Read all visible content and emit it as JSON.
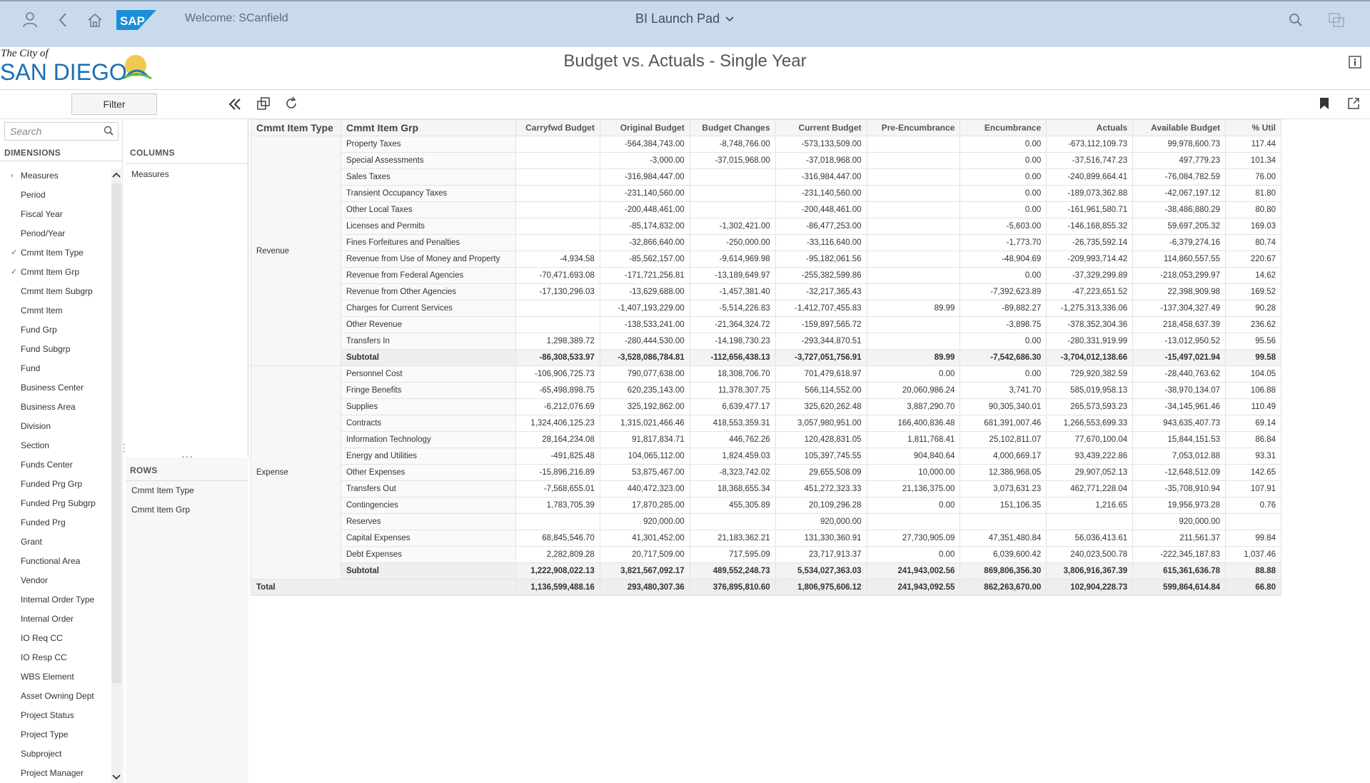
{
  "shell": {
    "welcome": "Welcome: SCanfield",
    "launchpad": "BI Launch Pad",
    "brand": "SAP"
  },
  "report": {
    "logo_top": "The City of",
    "logo_main": "SAN DIEGO",
    "title": "Budget vs. Actuals - Single Year"
  },
  "toolbar": {
    "filter_label": "Filter"
  },
  "dims": {
    "search_placeholder": "Search",
    "header": "DIMENSIONS",
    "items": [
      {
        "label": "Measures",
        "mark": "›"
      },
      {
        "label": "Period",
        "mark": ""
      },
      {
        "label": "Fiscal Year",
        "mark": ""
      },
      {
        "label": "Period/Year",
        "mark": ""
      },
      {
        "label": "Cmmt Item Type",
        "mark": "✓"
      },
      {
        "label": "Cmmt Item Grp",
        "mark": "✓"
      },
      {
        "label": "Cmmt Item Subgrp",
        "mark": ""
      },
      {
        "label": "Cmmt Item",
        "mark": ""
      },
      {
        "label": "Fund Grp",
        "mark": ""
      },
      {
        "label": "Fund Subgrp",
        "mark": ""
      },
      {
        "label": "Fund",
        "mark": ""
      },
      {
        "label": "Business Center",
        "mark": ""
      },
      {
        "label": "Business Area",
        "mark": ""
      },
      {
        "label": "Division",
        "mark": ""
      },
      {
        "label": "Section",
        "mark": ""
      },
      {
        "label": "Funds Center",
        "mark": ""
      },
      {
        "label": "Funded Prg Grp",
        "mark": ""
      },
      {
        "label": "Funded Prg Subgrp",
        "mark": ""
      },
      {
        "label": "Funded Prg",
        "mark": ""
      },
      {
        "label": "Grant",
        "mark": ""
      },
      {
        "label": "Functional Area",
        "mark": ""
      },
      {
        "label": "Vendor",
        "mark": ""
      },
      {
        "label": "Internal Order Type",
        "mark": ""
      },
      {
        "label": "Internal Order",
        "mark": ""
      },
      {
        "label": "IO Req CC",
        "mark": ""
      },
      {
        "label": "IO Resp CC",
        "mark": ""
      },
      {
        "label": "WBS Element",
        "mark": ""
      },
      {
        "label": "Asset Owning Dept",
        "mark": ""
      },
      {
        "label": "Project Status",
        "mark": ""
      },
      {
        "label": "Project Type",
        "mark": ""
      },
      {
        "label": "Subproject",
        "mark": ""
      },
      {
        "label": "Project Manager",
        "mark": ""
      }
    ]
  },
  "panels": {
    "columns_header": "COLUMNS",
    "columns": [
      "Measures"
    ],
    "rows_header": "ROWS",
    "rows": [
      "Cmmt Item Type",
      "Cmmt Item Grp"
    ]
  },
  "table": {
    "headers": [
      "Cmmt Item Type",
      "Cmmt Item Grp",
      "Carryfwd  Budget",
      "Original Budget",
      "Budget Changes",
      "Current Budget",
      "Pre-Encumbrance",
      "Encumbrance",
      "Actuals",
      "Available Budget",
      "% Util"
    ],
    "revenue_label": "Revenue",
    "revenue": [
      [
        "Property Taxes",
        "",
        "-564,384,743.00",
        "-8,748,766.00",
        "-573,133,509.00",
        "",
        "0.00",
        "-673,112,109.73",
        "99,978,600.73",
        "117.44"
      ],
      [
        "Special Assessments",
        "",
        "-3,000.00",
        "-37,015,968.00",
        "-37,018,968.00",
        "",
        "0.00",
        "-37,516,747.23",
        "497,779.23",
        "101.34"
      ],
      [
        "Sales Taxes",
        "",
        "-316,984,447.00",
        "",
        "-316,984,447.00",
        "",
        "0.00",
        "-240,899,664.41",
        "-76,084,782.59",
        "76.00"
      ],
      [
        "Transient Occupancy Taxes",
        "",
        "-231,140,560.00",
        "",
        "-231,140,560.00",
        "",
        "0.00",
        "-189,073,362.88",
        "-42,067,197.12",
        "81.80"
      ],
      [
        "Other Local Taxes",
        "",
        "-200,448,461.00",
        "",
        "-200,448,461.00",
        "",
        "0.00",
        "-161,961,580.71",
        "-38,486,880.29",
        "80.80"
      ],
      [
        "Licenses and Permits",
        "",
        "-85,174,832.00",
        "-1,302,421.00",
        "-86,477,253.00",
        "",
        "-5,603.00",
        "-146,168,855.32",
        "59,697,205.32",
        "169.03"
      ],
      [
        "Fines Forfeitures and Penalties",
        "",
        "-32,866,640.00",
        "-250,000.00",
        "-33,116,640.00",
        "",
        "-1,773.70",
        "-26,735,592.14",
        "-6,379,274.16",
        "80.74"
      ],
      [
        "Revenue from Use of Money and Property",
        "-4,934.58",
        "-85,562,157.00",
        "-9,614,969.98",
        "-95,182,061.56",
        "",
        "-48,904.69",
        "-209,993,714.42",
        "114,860,557.55",
        "220.67"
      ],
      [
        "Revenue from Federal Agencies",
        "-70,471,693.08",
        "-171,721,256.81",
        "-13,189,649.97",
        "-255,382,599.86",
        "",
        "0.00",
        "-37,329,299.89",
        "-218,053,299.97",
        "14.62"
      ],
      [
        "Revenue from Other Agencies",
        "-17,130,296.03",
        "-13,629,688.00",
        "-1,457,381.40",
        "-32,217,365.43",
        "",
        "-7,392,623.89",
        "-47,223,651.52",
        "22,398,909.98",
        "169.52"
      ],
      [
        "Charges for Current Services",
        "",
        "-1,407,193,229.00",
        "-5,514,226.83",
        "-1,412,707,455.83",
        "89.99",
        "-89,882.27",
        "-1,275,313,336.06",
        "-137,304,327.49",
        "90.28"
      ],
      [
        "Other Revenue",
        "",
        "-138,533,241.00",
        "-21,364,324.72",
        "-159,897,565.72",
        "",
        "-3,898.75",
        "-378,352,304.36",
        "218,458,637.39",
        "236.62"
      ],
      [
        "Transfers In",
        "1,298,389.72",
        "-280,444,530.00",
        "-14,198,730.23",
        "-293,344,870.51",
        "",
        "0.00",
        "-280,331,919.99",
        "-13,012,950.52",
        "95.56"
      ]
    ],
    "revenue_subtotal": [
      "Subtotal",
      "-86,308,533.97",
      "-3,528,086,784.81",
      "-112,656,438.13",
      "-3,727,051,756.91",
      "89.99",
      "-7,542,686.30",
      "-3,704,012,138.66",
      "-15,497,021.94",
      "99.58"
    ],
    "expense_label": "Expense",
    "expense": [
      [
        "Personnel Cost",
        "-106,906,725.73",
        "790,077,638.00",
        "18,308,706.70",
        "701,479,618.97",
        "0.00",
        "0.00",
        "729,920,382.59",
        "-28,440,763.62",
        "104.05"
      ],
      [
        "Fringe Benefits",
        "-65,498,898.75",
        "620,235,143.00",
        "11,378,307.75",
        "566,114,552.00",
        "20,060,986.24",
        "3,741.70",
        "585,019,958.13",
        "-38,970,134.07",
        "106.88"
      ],
      [
        "Supplies",
        "-6,212,076.69",
        "325,192,862.00",
        "6,639,477.17",
        "325,620,262.48",
        "3,887,290.70",
        "90,305,340.01",
        "265,573,593.23",
        "-34,145,961.46",
        "110.49"
      ],
      [
        "Contracts",
        "1,324,406,125.23",
        "1,315,021,466.46",
        "418,553,359.31",
        "3,057,980,951.00",
        "166,400,836.48",
        "681,391,007.46",
        "1,266,553,699.33",
        "943,635,407.73",
        "69.14"
      ],
      [
        "Information Technology",
        "28,164,234.08",
        "91,817,834.71",
        "446,762.26",
        "120,428,831.05",
        "1,811,768.41",
        "25,102,811.07",
        "77,670,100.04",
        "15,844,151.53",
        "86.84"
      ],
      [
        "Energy and Utilities",
        "-491,825.48",
        "104,065,112.00",
        "1,824,459.03",
        "105,397,745.55",
        "904,840.64",
        "4,000,669.17",
        "93,439,222.86",
        "7,053,012.88",
        "93.31"
      ],
      [
        "Other Expenses",
        "-15,896,216.89",
        "53,875,467.00",
        "-8,323,742.02",
        "29,655,508.09",
        "10,000.00",
        "12,386,968.05",
        "29,907,052.13",
        "-12,648,512.09",
        "142.65"
      ],
      [
        "Transfers Out",
        "-7,568,655.01",
        "440,472,323.00",
        "18,368,655.34",
        "451,272,323.33",
        "21,136,375.00",
        "3,073,631.23",
        "462,771,228.04",
        "-35,708,910.94",
        "107.91"
      ],
      [
        "Contingencies",
        "1,783,705.39",
        "17,870,285.00",
        "455,305.89",
        "20,109,296.28",
        "0.00",
        "151,106.35",
        "1,216.65",
        "19,956,973.28",
        "0.76"
      ],
      [
        "Reserves",
        "",
        "920,000.00",
        "",
        "920,000.00",
        "",
        "",
        "",
        "920,000.00",
        ""
      ],
      [
        "Capital Expenses",
        "68,845,546.70",
        "41,301,452.00",
        "21,183,362.21",
        "131,330,360.91",
        "27,730,905.09",
        "47,351,480.84",
        "56,036,413.61",
        "211,561.37",
        "99.84"
      ],
      [
        "Debt Expenses",
        "2,282,809.28",
        "20,717,509.00",
        "717,595.09",
        "23,717,913.37",
        "0.00",
        "6,039,600.42",
        "240,023,500.78",
        "-222,345,187.83",
        "1,037.46"
      ]
    ],
    "expense_subtotal": [
      "Subtotal",
      "1,222,908,022.13",
      "3,821,567,092.17",
      "489,552,248.73",
      "5,534,027,363.03",
      "241,943,002.56",
      "869,806,356.30",
      "3,806,916,367.39",
      "615,361,636.78",
      "88.88"
    ],
    "total": [
      "Total",
      "1,136,599,488.16",
      "293,480,307.36",
      "376,895,810.60",
      "1,806,975,606.12",
      "241,943,092.55",
      "862,263,670.00",
      "102,904,228.73",
      "599,864,614.84",
      "66.80"
    ]
  }
}
